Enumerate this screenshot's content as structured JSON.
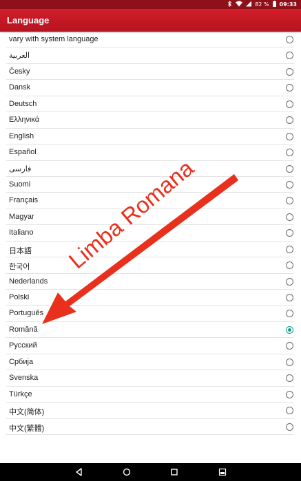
{
  "status_bar": {
    "battery": "82 %",
    "time": "09:33",
    "icons": [
      "bluetooth-icon",
      "wifi-icon",
      "signal-icon",
      "battery-icon"
    ]
  },
  "app_bar": {
    "title": "Language"
  },
  "languages": [
    {
      "label": "vary with system language",
      "selected": false
    },
    {
      "label": "العربية",
      "selected": false
    },
    {
      "label": "Česky",
      "selected": false
    },
    {
      "label": "Dansk",
      "selected": false
    },
    {
      "label": "Deutsch",
      "selected": false
    },
    {
      "label": "Ελληνικά",
      "selected": false
    },
    {
      "label": "English",
      "selected": false
    },
    {
      "label": "Español",
      "selected": false
    },
    {
      "label": "فارسی",
      "selected": false
    },
    {
      "label": "Suomi",
      "selected": false
    },
    {
      "label": "Français",
      "selected": false
    },
    {
      "label": "Magyar",
      "selected": false
    },
    {
      "label": "Italiano",
      "selected": false
    },
    {
      "label": "日本語",
      "selected": false
    },
    {
      "label": "한국어",
      "selected": false
    },
    {
      "label": "Nederlands",
      "selected": false
    },
    {
      "label": "Polski",
      "selected": false
    },
    {
      "label": "Português",
      "selected": false
    },
    {
      "label": "Română",
      "selected": true
    },
    {
      "label": "Русский",
      "selected": false
    },
    {
      "label": "Србија",
      "selected": false
    },
    {
      "label": "Svenska",
      "selected": false
    },
    {
      "label": "Türkçe",
      "selected": false
    },
    {
      "label": "中文(简体)",
      "selected": false
    },
    {
      "label": "中文(繁體)",
      "selected": false
    }
  ],
  "annotation": {
    "text": "Limba Romana",
    "color": "#e8301c"
  },
  "nav_bar": {
    "buttons": [
      "back-icon",
      "home-icon",
      "recents-icon",
      "screenshot-icon"
    ]
  },
  "colors": {
    "app_bar": "#c8192a",
    "radio_selected": "#1a9a8c"
  }
}
